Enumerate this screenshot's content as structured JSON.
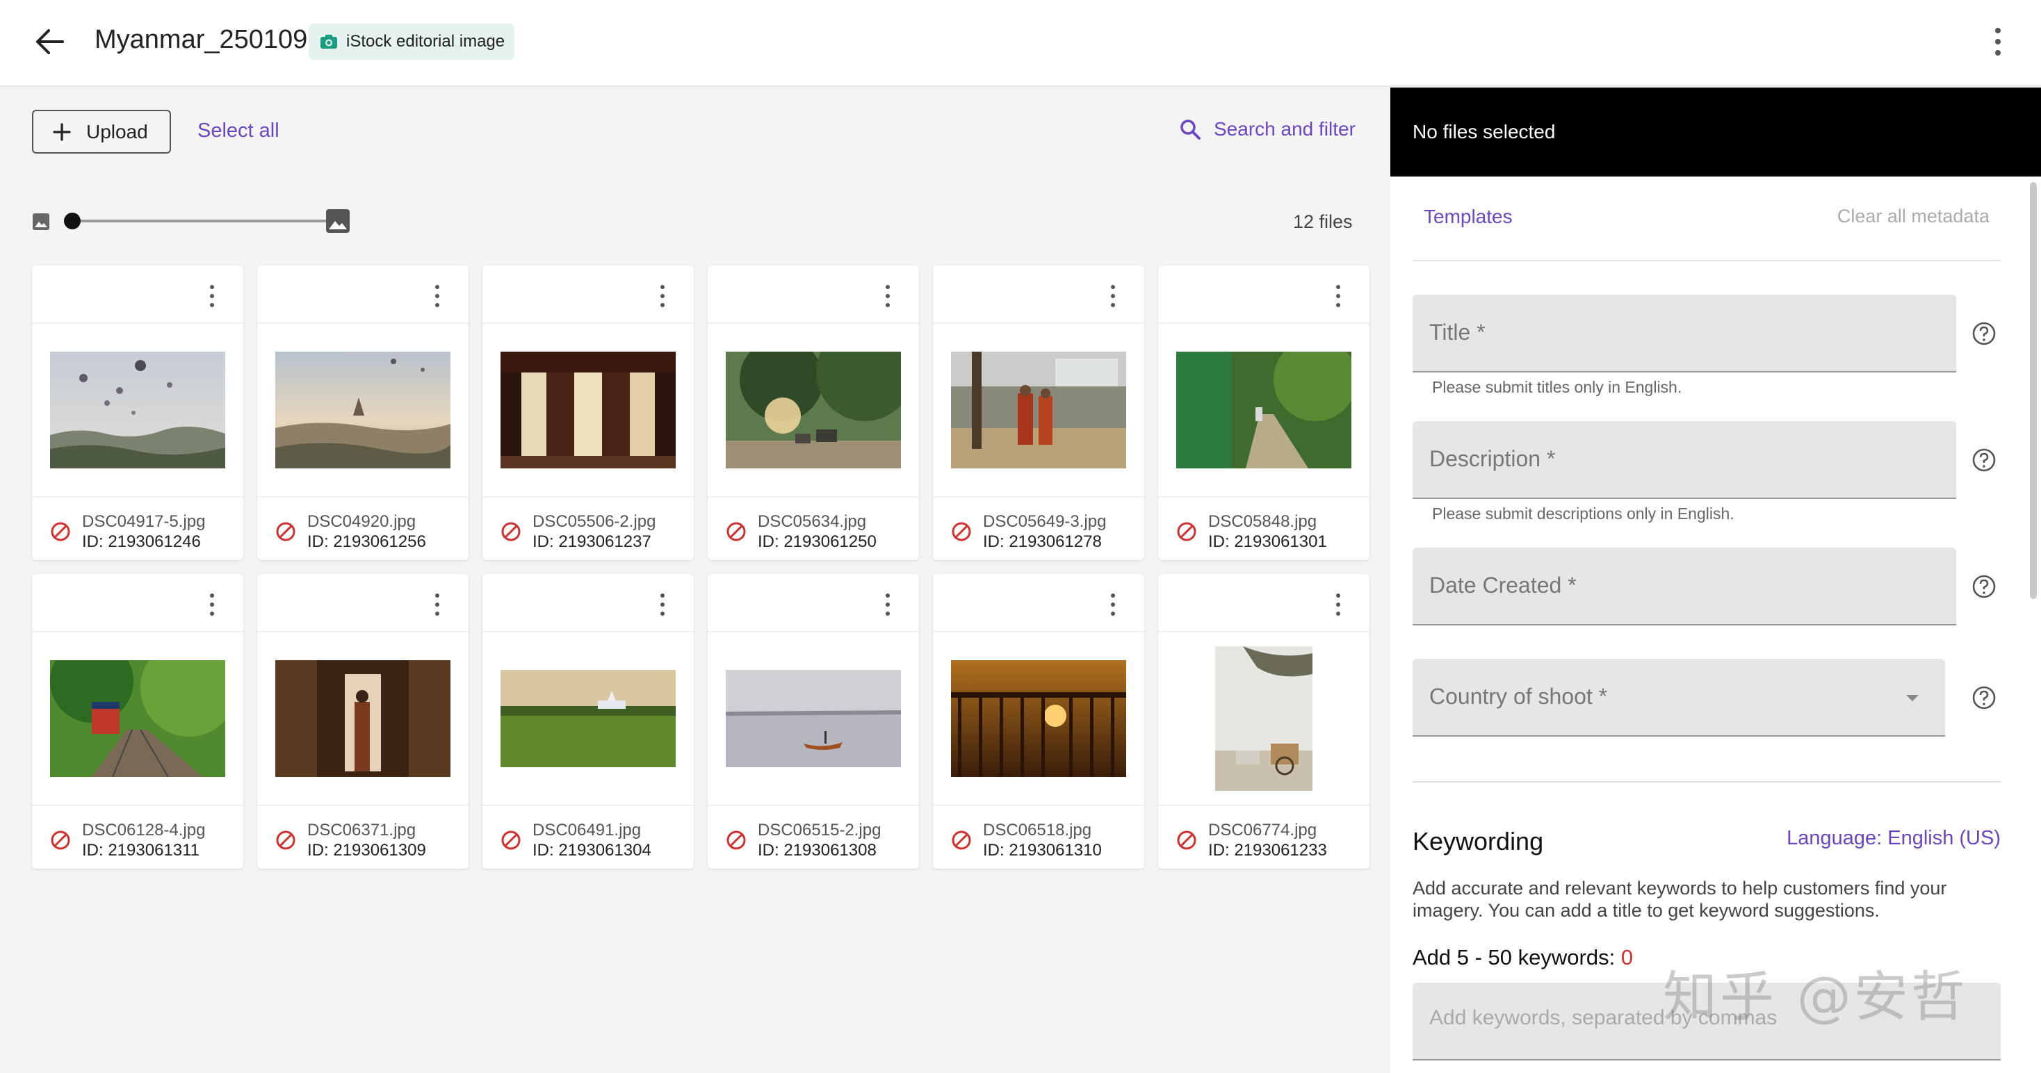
{
  "header": {
    "title": "Myanmar_250109",
    "badge_label": "iStock editorial image",
    "badge_color": "#1a9d7e"
  },
  "toolbar": {
    "upload_label": "Upload",
    "select_all_label": "Select all",
    "search_filter_label": "Search and filter"
  },
  "gallery": {
    "file_count": "12 files",
    "thumbnail_size_level": 0,
    "files": [
      {
        "name": "DSC04917-5.jpg",
        "id": "ID: 2193061246"
      },
      {
        "name": "DSC04920.jpg",
        "id": "ID: 2193061256"
      },
      {
        "name": "DSC05506-2.jpg",
        "id": "ID: 2193061237"
      },
      {
        "name": "DSC05634.jpg",
        "id": "ID: 2193061250"
      },
      {
        "name": "DSC05649-3.jpg",
        "id": "ID: 2193061278"
      },
      {
        "name": "DSC05848.jpg",
        "id": "ID: 2193061301"
      },
      {
        "name": "DSC06128-4.jpg",
        "id": "ID: 2193061311"
      },
      {
        "name": "DSC06371.jpg",
        "id": "ID: 2193061309"
      },
      {
        "name": "DSC06491.jpg",
        "id": "ID: 2193061304"
      },
      {
        "name": "DSC06515-2.jpg",
        "id": "ID: 2193061308"
      },
      {
        "name": "DSC06518.jpg",
        "id": "ID: 2193061310"
      },
      {
        "name": "DSC06774.jpg",
        "id": "ID: 2193061233"
      }
    ]
  },
  "sidebar": {
    "selection_status": "No files selected",
    "templates_label": "Templates",
    "clear_metadata_label": "Clear all metadata",
    "title_field": {
      "label": "Title *",
      "hint": "Please submit titles only in English."
    },
    "description_field": {
      "label": "Description *",
      "hint": "Please submit descriptions only in English."
    },
    "date_field": {
      "label": "Date Created *"
    },
    "country_field": {
      "label": "Country of shoot *"
    },
    "keywording": {
      "title": "Keywording",
      "language_label": "Language: English (US)",
      "description": "Add accurate and relevant keywords to help customers find your imagery. You can add a title to get keyword suggestions.",
      "count_label": "Add 5 - 50 keywords:",
      "count_value": "0",
      "input_placeholder": "Add keywords, separated by commas"
    }
  },
  "watermark": "知乎 @安哲",
  "colors": {
    "accent": "#6b46c1",
    "error": "#d32f2f",
    "panel_dark": "#000000"
  }
}
